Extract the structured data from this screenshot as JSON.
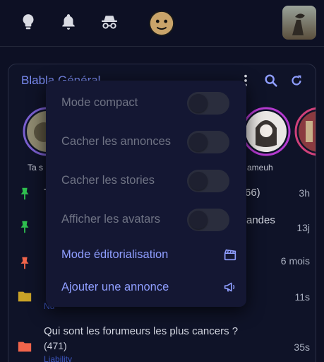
{
  "card": {
    "title": "Blabla Général"
  },
  "stories": [
    {
      "label": "Ta s"
    },
    {
      "label": "ameuh"
    }
  ],
  "topics": [
    {
      "title": "T",
      "count": "66)",
      "time": "3h",
      "pinned": true
    },
    {
      "title": "",
      "title_end": "andes",
      "time": "13j",
      "pinned": true
    },
    {
      "title": "",
      "time": "6 mois",
      "pinned": true
    },
    {
      "title": "",
      "tag": "Nu",
      "time": "11s",
      "folder": true
    },
    {
      "title": "Qui sont les forumeurs les plus cancers ?",
      "count": "(471)",
      "tag": "Liability",
      "time": "35s",
      "folder": true
    }
  ],
  "menu": {
    "toggles": [
      {
        "label": "Mode compact",
        "on": false
      },
      {
        "label": "Cacher les annonces",
        "on": false
      },
      {
        "label": "Cacher les stories",
        "on": false
      },
      {
        "label": "Afficher les avatars",
        "on": false
      }
    ],
    "actions": [
      {
        "label": "Mode éditorialisation",
        "icon": "clapperboard-icon"
      },
      {
        "label": "Ajouter une annonce",
        "icon": "megaphone-icon"
      }
    ]
  },
  "colors": {
    "accent": "#8f9eff",
    "pin_green": "#2fbf4f",
    "pin_red": "#f0644b",
    "folder_gold": "#c9a227",
    "folder_orange": "#f0644b"
  }
}
